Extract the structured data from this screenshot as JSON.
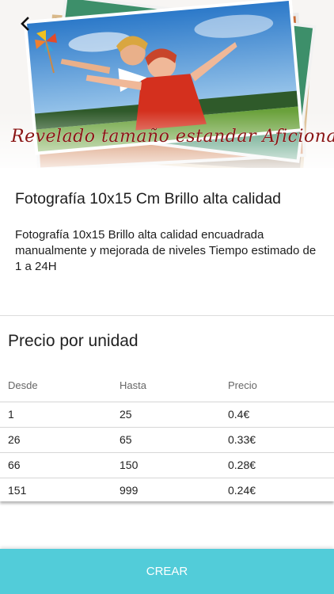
{
  "hero": {
    "caption": "Revelado tamaño estandar Aficionado",
    "back_icon": "chevron-left-icon"
  },
  "product": {
    "title": "Fotografía 10x15 Cm Brillo alta calidad",
    "description": "Fotografía 10x15 Brillo alta calidad  encuadrada manualmente y mejorada de niveles Tiempo estimado de 1 a 24H"
  },
  "price_table": {
    "title": "Precio por unidad",
    "headers": [
      "Desde",
      "Hasta",
      "Precio"
    ],
    "rows": [
      [
        "1",
        "25",
        "0.4€"
      ],
      [
        "26",
        "65",
        "0.33€"
      ],
      [
        "66",
        "150",
        "0.28€"
      ],
      [
        "151",
        "999",
        "0.24€"
      ]
    ]
  },
  "actions": {
    "create_label": "CREAR"
  },
  "colors": {
    "accent": "#52ccd9",
    "caption": "#8a1414"
  }
}
